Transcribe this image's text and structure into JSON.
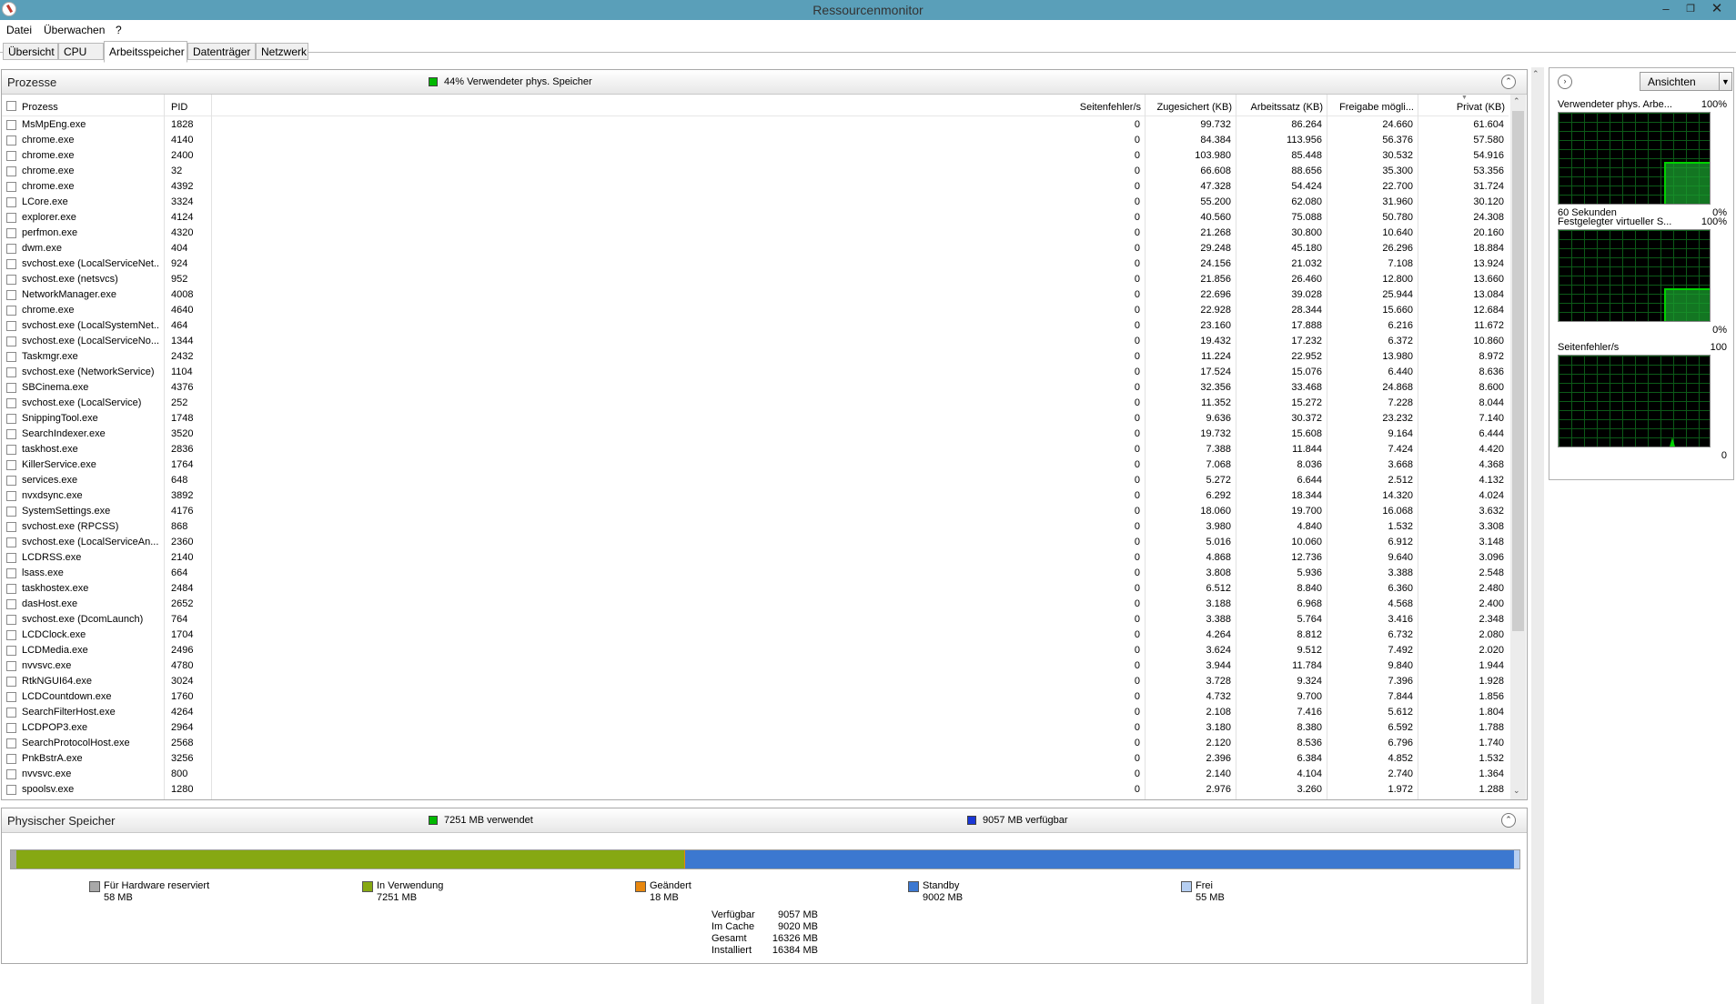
{
  "window": {
    "title": "Ressourcenmonitor"
  },
  "menu": [
    "Datei",
    "Überwachen",
    "?"
  ],
  "tabs": [
    "Übersicht",
    "CPU",
    "Arbeitsspeicher",
    "Datenträger",
    "Netzwerk"
  ],
  "processes": {
    "title": "Prozesse",
    "usage_label": "44% Verwendeter phys. Speicher",
    "columns": [
      "Prozess",
      "PID",
      "Seitenfehler/s",
      "Zugesichert (KB)",
      "Arbeitssatz (KB)",
      "Freigabe mögli...",
      "Privat (KB)"
    ],
    "rows": [
      [
        "MsMpEng.exe",
        "1828",
        "0",
        "99.732",
        "86.264",
        "24.660",
        "61.604"
      ],
      [
        "chrome.exe",
        "4140",
        "0",
        "84.384",
        "113.956",
        "56.376",
        "57.580"
      ],
      [
        "chrome.exe",
        "2400",
        "0",
        "103.980",
        "85.448",
        "30.532",
        "54.916"
      ],
      [
        "chrome.exe",
        "32",
        "0",
        "66.608",
        "88.656",
        "35.300",
        "53.356"
      ],
      [
        "chrome.exe",
        "4392",
        "0",
        "47.328",
        "54.424",
        "22.700",
        "31.724"
      ],
      [
        "LCore.exe",
        "3324",
        "0",
        "55.200",
        "62.080",
        "31.960",
        "30.120"
      ],
      [
        "explorer.exe",
        "4124",
        "0",
        "40.560",
        "75.088",
        "50.780",
        "24.308"
      ],
      [
        "perfmon.exe",
        "4320",
        "0",
        "21.268",
        "30.800",
        "10.640",
        "20.160"
      ],
      [
        "dwm.exe",
        "404",
        "0",
        "29.248",
        "45.180",
        "26.296",
        "18.884"
      ],
      [
        "svchost.exe (LocalServiceNet...",
        "924",
        "0",
        "24.156",
        "21.032",
        "7.108",
        "13.924"
      ],
      [
        "svchost.exe (netsvcs)",
        "952",
        "0",
        "21.856",
        "26.460",
        "12.800",
        "13.660"
      ],
      [
        "NetworkManager.exe",
        "4008",
        "0",
        "22.696",
        "39.028",
        "25.944",
        "13.084"
      ],
      [
        "chrome.exe",
        "4640",
        "0",
        "22.928",
        "28.344",
        "15.660",
        "12.684"
      ],
      [
        "svchost.exe (LocalSystemNet...",
        "464",
        "0",
        "23.160",
        "17.888",
        "6.216",
        "11.672"
      ],
      [
        "svchost.exe (LocalServiceNo...",
        "1344",
        "0",
        "19.432",
        "17.232",
        "6.372",
        "10.860"
      ],
      [
        "Taskmgr.exe",
        "2432",
        "0",
        "11.224",
        "22.952",
        "13.980",
        "8.972"
      ],
      [
        "svchost.exe (NetworkService)",
        "1104",
        "0",
        "17.524",
        "15.076",
        "6.440",
        "8.636"
      ],
      [
        "SBCinema.exe",
        "4376",
        "0",
        "32.356",
        "33.468",
        "24.868",
        "8.600"
      ],
      [
        "svchost.exe (LocalService)",
        "252",
        "0",
        "11.352",
        "15.272",
        "7.228",
        "8.044"
      ],
      [
        "SnippingTool.exe",
        "1748",
        "0",
        "9.636",
        "30.372",
        "23.232",
        "7.140"
      ],
      [
        "SearchIndexer.exe",
        "3520",
        "0",
        "19.732",
        "15.608",
        "9.164",
        "6.444"
      ],
      [
        "taskhost.exe",
        "2836",
        "0",
        "7.388",
        "11.844",
        "7.424",
        "4.420"
      ],
      [
        "KillerService.exe",
        "1764",
        "0",
        "7.068",
        "8.036",
        "3.668",
        "4.368"
      ],
      [
        "services.exe",
        "648",
        "0",
        "5.272",
        "6.644",
        "2.512",
        "4.132"
      ],
      [
        "nvxdsync.exe",
        "3892",
        "0",
        "6.292",
        "18.344",
        "14.320",
        "4.024"
      ],
      [
        "SystemSettings.exe",
        "4176",
        "0",
        "18.060",
        "19.700",
        "16.068",
        "3.632"
      ],
      [
        "svchost.exe (RPCSS)",
        "868",
        "0",
        "3.980",
        "4.840",
        "1.532",
        "3.308"
      ],
      [
        "svchost.exe (LocalServiceAn...",
        "2360",
        "0",
        "5.016",
        "10.060",
        "6.912",
        "3.148"
      ],
      [
        "LCDRSS.exe",
        "2140",
        "0",
        "4.868",
        "12.736",
        "9.640",
        "3.096"
      ],
      [
        "lsass.exe",
        "664",
        "0",
        "3.808",
        "5.936",
        "3.388",
        "2.548"
      ],
      [
        "taskhostex.exe",
        "2484",
        "0",
        "6.512",
        "8.840",
        "6.360",
        "2.480"
      ],
      [
        "dasHost.exe",
        "2652",
        "0",
        "3.188",
        "6.968",
        "4.568",
        "2.400"
      ],
      [
        "svchost.exe (DcomLaunch)",
        "764",
        "0",
        "3.388",
        "5.764",
        "3.416",
        "2.348"
      ],
      [
        "LCDClock.exe",
        "1704",
        "0",
        "4.264",
        "8.812",
        "6.732",
        "2.080"
      ],
      [
        "LCDMedia.exe",
        "2496",
        "0",
        "3.624",
        "9.512",
        "7.492",
        "2.020"
      ],
      [
        "nvvsvc.exe",
        "4780",
        "0",
        "3.944",
        "11.784",
        "9.840",
        "1.944"
      ],
      [
        "RtkNGUI64.exe",
        "3024",
        "0",
        "3.728",
        "9.324",
        "7.396",
        "1.928"
      ],
      [
        "LCDCountdown.exe",
        "1760",
        "0",
        "4.732",
        "9.700",
        "7.844",
        "1.856"
      ],
      [
        "SearchFilterHost.exe",
        "4264",
        "0",
        "2.108",
        "7.416",
        "5.612",
        "1.804"
      ],
      [
        "LCDPOP3.exe",
        "2964",
        "0",
        "3.180",
        "8.380",
        "6.592",
        "1.788"
      ],
      [
        "SearchProtocolHost.exe",
        "2568",
        "0",
        "2.120",
        "8.536",
        "6.796",
        "1.740"
      ],
      [
        "PnkBstrA.exe",
        "3256",
        "0",
        "2.396",
        "6.384",
        "4.852",
        "1.532"
      ],
      [
        "nvvsvc.exe",
        "800",
        "0",
        "2.140",
        "4.104",
        "2.740",
        "1.364"
      ],
      [
        "spoolsv.exe",
        "1280",
        "0",
        "2.976",
        "3.260",
        "1.972",
        "1.288"
      ]
    ]
  },
  "physical": {
    "title": "Physischer Speicher",
    "used_label": "7251 MB verwendet",
    "available_label": "9057 MB verfügbar",
    "bar": {
      "reserved_mb": 58,
      "in_use_mb": 7251,
      "modified_mb": 18,
      "standby_mb": 9002,
      "free_mb": 55,
      "total_mb": 16384
    },
    "legend": [
      {
        "label": "Für Hardware reserviert",
        "value": "58 MB",
        "color": "#a8a8a8"
      },
      {
        "label": "In Verwendung",
        "value": "7251 MB",
        "color": "#86a813"
      },
      {
        "label": "Geändert",
        "value": "18 MB",
        "color": "#e8870e"
      },
      {
        "label": "Standby",
        "value": "9002 MB",
        "color": "#3c78d0"
      },
      {
        "label": "Frei",
        "value": "55 MB",
        "color": "#b6cff2"
      }
    ],
    "stats": [
      {
        "label": "Verfügbar",
        "value": "9057 MB"
      },
      {
        "label": "Im Cache",
        "value": "9020 MB"
      },
      {
        "label": "Gesamt",
        "value": "16326 MB"
      },
      {
        "label": "Installiert",
        "value": "16384 MB"
      }
    ]
  },
  "right": {
    "views_label": "Ansichten",
    "graphs": [
      {
        "title": "Verwendeter phys. Arbe...",
        "max": "100%",
        "footer_left": "60 Sekunden",
        "footer_right": "0%",
        "level": 0.44
      },
      {
        "title": "Festgelegter virtueller S...",
        "max": "100%",
        "footer_left": "",
        "footer_right": "0%",
        "level": 0.34
      },
      {
        "title": "Seitenfehler/s",
        "max": "100",
        "footer_left": "",
        "footer_right": "0",
        "level": 0.0
      }
    ]
  },
  "colors": {
    "titlebar": "#5a9fb9",
    "graph_line": "#00d100",
    "graph_fill": "#1a9e2e"
  }
}
